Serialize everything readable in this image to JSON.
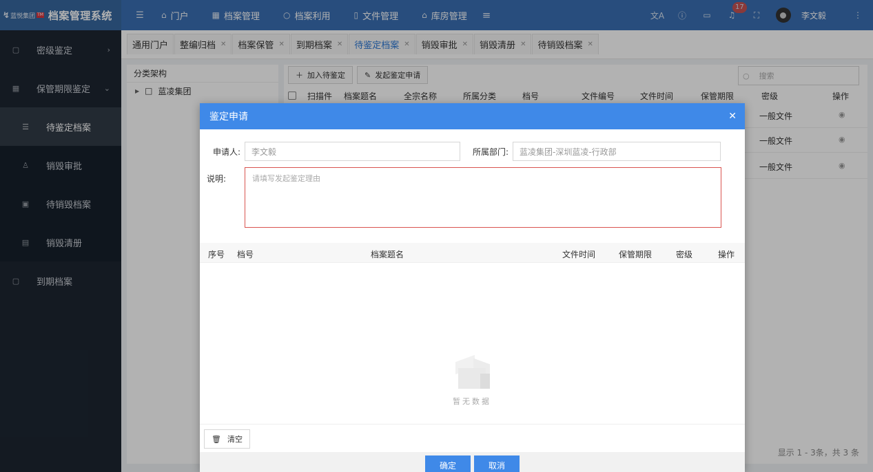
{
  "brand": {
    "logo_text": "蓝悦集团",
    "logo_tag": "TM",
    "system_name": "档案管理系统"
  },
  "topnav": {
    "items": [
      {
        "label": "门户",
        "icon": "home-icon"
      },
      {
        "label": "档案管理",
        "icon": "calendar-icon"
      },
      {
        "label": "档案利用",
        "icon": "search-icon"
      },
      {
        "label": "文件管理",
        "icon": "file-icon"
      },
      {
        "label": "库房管理",
        "icon": "warehouse-icon"
      }
    ],
    "notifications_count": "17",
    "user_name": "李文毅"
  },
  "sidebar": {
    "items": [
      {
        "label": "密级鉴定",
        "icon": "document-icon"
      },
      {
        "label": "保管期限鉴定",
        "icon": "grid-icon"
      },
      {
        "label": "待鉴定档案",
        "icon": "list-icon"
      },
      {
        "label": "销毁审批",
        "icon": "user-icon"
      },
      {
        "label": "待销毁档案",
        "icon": "image-icon"
      },
      {
        "label": "销毁清册",
        "icon": "clipboard-icon"
      },
      {
        "label": "到期档案",
        "icon": "document-icon"
      }
    ]
  },
  "tabs": [
    {
      "label": "通用门户"
    },
    {
      "label": "整编归档"
    },
    {
      "label": "档案保管"
    },
    {
      "label": "到期档案"
    },
    {
      "label": "待鉴定档案"
    },
    {
      "label": "销毁审批"
    },
    {
      "label": "销毁清册"
    },
    {
      "label": "待销毁档案"
    }
  ],
  "tree": {
    "header": "分类架构",
    "root": "蓝凌集团"
  },
  "toolbar": {
    "add_label": "加入待鉴定",
    "apply_label": "发起鉴定申请",
    "search_placeholder": "搜索"
  },
  "grid": {
    "columns": [
      "扫描件",
      "档案题名",
      "全宗名称",
      "所属分类",
      "档号",
      "文件编号",
      "文件时间",
      "保管期限",
      "密级",
      "操作"
    ],
    "rows": [
      {
        "level": "一般文件"
      },
      {
        "level": "一般文件"
      },
      {
        "level": "一般文件"
      }
    ],
    "pagination": "显示 1 - 3条，共 3 条"
  },
  "modal": {
    "title": "鉴定申请",
    "applicant_label": "申请人:",
    "applicant_value": "李文毅",
    "dept_label": "所属部门:",
    "dept_value": "蓝凌集团-深圳蓝凌-行政部",
    "desc_label": "说明:",
    "desc_placeholder": "请填写发起鉴定理由",
    "table_columns": [
      "序号",
      "档号",
      "档案题名",
      "文件时间",
      "保管期限",
      "密级",
      "操作"
    ],
    "empty_text": "暂无数据",
    "clear_label": "清空",
    "confirm_label": "确定",
    "cancel_label": "取消"
  }
}
